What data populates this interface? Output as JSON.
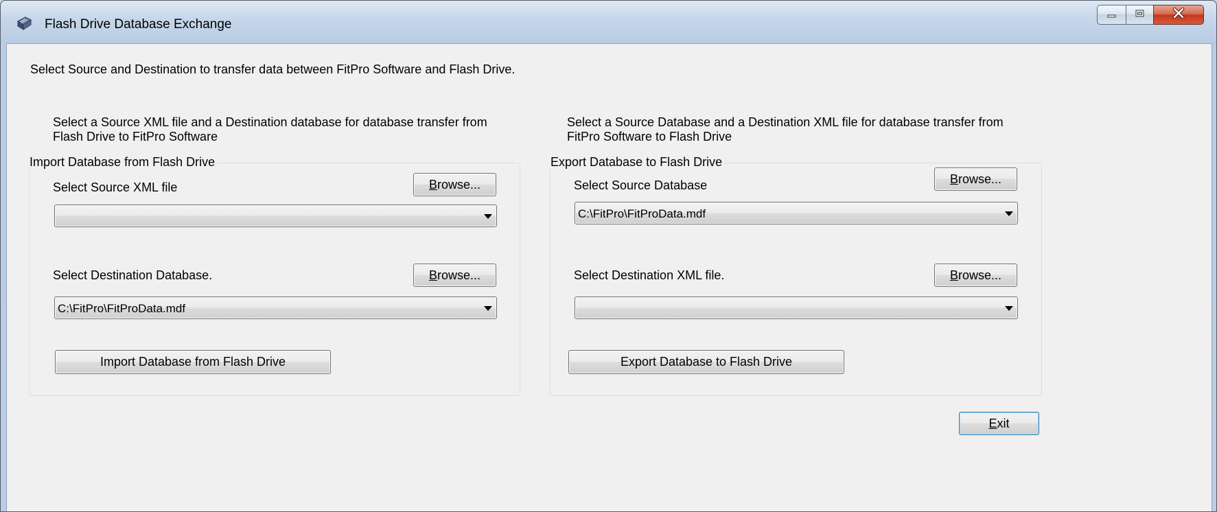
{
  "window": {
    "title": "Flash Drive Database Exchange"
  },
  "intro_text": "Select Source and Destination to transfer data between FitPro Software and Flash Drive.",
  "import": {
    "description_line1": "Select a Source XML file and a Destination database for database transfer from",
    "description_line2": "Flash Drive to FitPro Software",
    "group_title": "Import Database from Flash Drive",
    "source_label": "Select Source XML file",
    "source_value": "",
    "browse_source": {
      "accel": "B",
      "rest": "rowse..."
    },
    "destination_label": "Select Destination Database.",
    "destination_value": "C:\\FitPro\\FitProData.mdf",
    "browse_destination": {
      "accel": "B",
      "rest": "rowse..."
    },
    "action_label": "Import Database from Flash Drive"
  },
  "export": {
    "description_line1": "Select a Source Database and a Destination XML file for database transfer from",
    "description_line2": "FitPro Software to Flash Drive",
    "group_title": "Export Database to Flash Drive",
    "source_label": "Select Source Database",
    "source_value": "C:\\FitPro\\FitProData.mdf",
    "browse_source": {
      "accel": "B",
      "rest": "rowse..."
    },
    "destination_label": "Select Destination XML file.",
    "destination_value": "",
    "browse_destination": {
      "accel": "B",
      "rest": "rowse..."
    },
    "action_label": "Export  Database to Flash Drive"
  },
  "exit_button": {
    "accel": "E",
    "rest": "xit"
  },
  "icons": {
    "app": "flash-drive-database-icon",
    "minimize": "minimize-icon",
    "maximize": "maximize-icon",
    "close": "close-icon",
    "dropdown": "chevron-down-icon"
  },
  "colors": {
    "window_frame": "#bccde3",
    "client_background": "#f0f0f0",
    "close_button": "#c2391c",
    "default_button_border": "#3c7fb1"
  }
}
